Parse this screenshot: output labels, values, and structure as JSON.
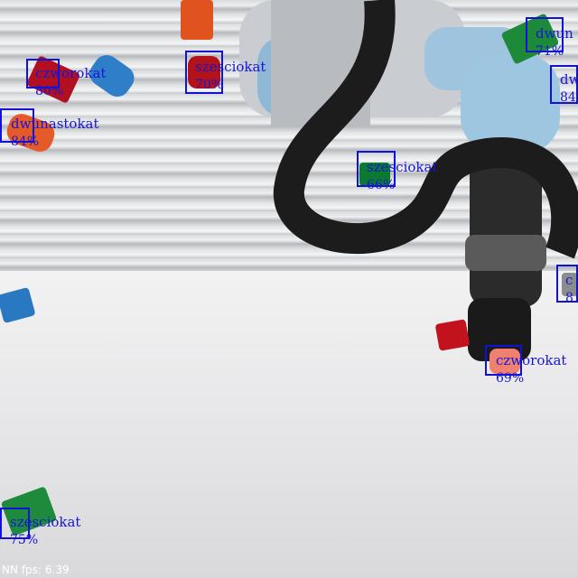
{
  "detections": [
    {
      "label": "czworokat",
      "score": "80%"
    },
    {
      "label": "szesciokat",
      "score": "70%"
    },
    {
      "label": "dwunastokat",
      "score": "84%"
    },
    {
      "label": "szesciokat",
      "score": "66%"
    },
    {
      "label": "dwun",
      "score": "71%"
    },
    {
      "label": "dw",
      "score": "84"
    },
    {
      "label": "c",
      "score": "8"
    },
    {
      "label": "czworokat",
      "score": "69%"
    },
    {
      "label": "szesciokat",
      "score": "75%"
    }
  ],
  "status": {
    "fps_label": "NN fps:",
    "fps_value": "6.39"
  },
  "colors": {
    "box": "#1212d4",
    "label": "#1616d8"
  }
}
